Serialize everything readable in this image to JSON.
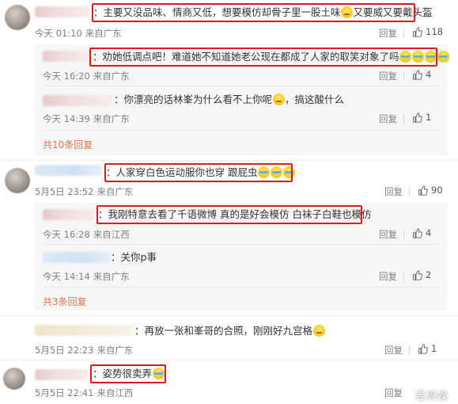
{
  "comments": [
    {
      "text": "：主要又没品味、情商又低，想要模仿却骨子里一股土味",
      "text_suffix": "又要威又要戴头盔",
      "time": "今天 01:10",
      "source": "来自广东",
      "reply_label": "回复",
      "likes": "118",
      "replies": [
        {
          "text": "：劝她低调点吧！难道她不知道她老公现在都成了人家的取笑对象了吗",
          "time": "今天 16:20",
          "source": "来自广东",
          "reply_label": "回复",
          "likes": "4"
        },
        {
          "text": "：你漂亮的话林峯为什么看不上你呢",
          "text_suffix": "，搞这酸什么",
          "time": "今天 14:39",
          "source": "来自广东",
          "reply_label": "回复",
          "likes": "1"
        }
      ],
      "more_replies": "共10条回复"
    },
    {
      "text": "：人家穿白色运动服你也穿 跟屁虫",
      "time": "5月5日 23:52",
      "source": "来自广东",
      "reply_label": "回复",
      "likes": "90",
      "replies": [
        {
          "text": "：我刚特意去看了千语微博 真的是好会模仿 白袜子白鞋也模仿",
          "time": "今天 16:28",
          "source": "来自江西",
          "reply_label": "回复",
          "likes": "4"
        },
        {
          "text": "：关你p事",
          "time": "今天 14:14",
          "source": "来自广东",
          "reply_label": "回复",
          "likes": "2"
        }
      ],
      "more_replies": "共3条回复"
    },
    {
      "text": "：再放一张和峯哥的合照，刚刚好九宫格",
      "time": "5月5日 22:23",
      "source": "来自广东",
      "reply_label": "回复",
      "likes": "1"
    },
    {
      "text": "：姿势很卖弄",
      "time": "5月5日 22:41",
      "source": "来自江西",
      "reply_label": "回复"
    }
  ],
  "watermark": "壹周娱",
  "colors": {
    "highlight": "#e0191e",
    "link": "#eb7350",
    "meta": "#808080"
  }
}
